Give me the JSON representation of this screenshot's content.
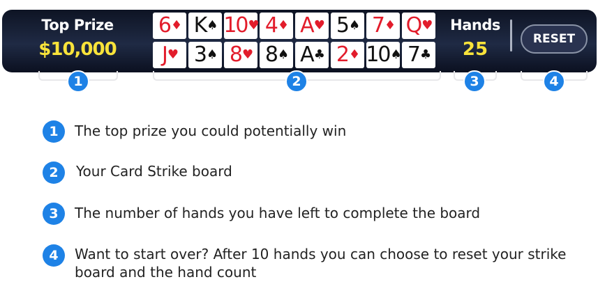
{
  "header": {
    "top_prize_label": "Top Prize",
    "top_prize_value": "$10,000",
    "hands_label": "Hands",
    "hands_value": "25",
    "reset_label": "RESET"
  },
  "board": {
    "row1": [
      {
        "rank": "6",
        "suit": "♦",
        "color": "red"
      },
      {
        "rank": "K",
        "suit": "♠",
        "color": "black"
      },
      {
        "rank": "10",
        "suit": "♥",
        "color": "red"
      },
      {
        "rank": "4",
        "suit": "♦",
        "color": "red"
      },
      {
        "rank": "A",
        "suit": "♥",
        "color": "red"
      },
      {
        "rank": "5",
        "suit": "♠",
        "color": "black"
      },
      {
        "rank": "7",
        "suit": "♦",
        "color": "red"
      },
      {
        "rank": "Q",
        "suit": "♥",
        "color": "red"
      }
    ],
    "row2": [
      {
        "rank": "J",
        "suit": "♥",
        "color": "red"
      },
      {
        "rank": "3",
        "suit": "♠",
        "color": "black"
      },
      {
        "rank": "8",
        "suit": "♥",
        "color": "red"
      },
      {
        "rank": "8",
        "suit": "♠",
        "color": "black"
      },
      {
        "rank": "A",
        "suit": "♣",
        "color": "black"
      },
      {
        "rank": "2",
        "suit": "♦",
        "color": "red"
      },
      {
        "rank": "10",
        "suit": "♠",
        "color": "black"
      },
      {
        "rank": "7",
        "suit": "♣",
        "color": "black"
      }
    ]
  },
  "callouts": [
    {
      "number": "1",
      "text": "The top prize you could potentially win"
    },
    {
      "number": "2",
      "text": "Your Card Strike board"
    },
    {
      "number": "3",
      "text": "The number of hands you have left to complete the board"
    },
    {
      "number": "4",
      "text": "Want to start over? After 10 hands you can choose to reset your strike board and the hand count"
    }
  ],
  "colors": {
    "accent_blue": "#1e82e6",
    "prize_yellow": "#f8e33a",
    "card_red": "#e21c2b",
    "bar_dark": "#141b2e"
  }
}
